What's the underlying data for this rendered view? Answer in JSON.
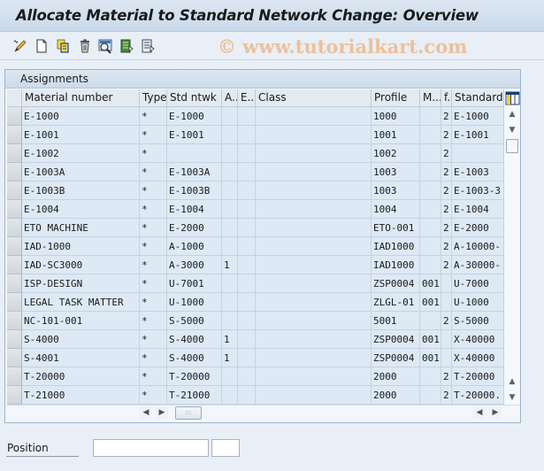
{
  "title": "Allocate Material to Standard Network Change: Overview",
  "watermark": "© www.tutorialkart.com",
  "toolbar": {
    "icons": [
      "display-change-icon",
      "new-entries-icon",
      "copy-as-icon",
      "delete-icon",
      "select-all-icon",
      "select-block-icon",
      "deselect-all-icon"
    ]
  },
  "table": {
    "section_title": "Assignments",
    "columns": [
      "Material number",
      "Type",
      "Std ntwk",
      "A..",
      "E..",
      "Class",
      "Profile",
      "M...",
      "f.",
      "Standard"
    ],
    "rows": [
      [
        "E-1000",
        "*",
        "E-1000",
        "",
        "",
        "",
        "1000",
        "",
        "2",
        "E-1000"
      ],
      [
        "E-1001",
        "*",
        "E-1001",
        "",
        "",
        "",
        "1001",
        "",
        "2",
        "E-1001"
      ],
      [
        "E-1002",
        "*",
        "",
        "",
        "",
        "",
        "1002",
        "",
        "2",
        ""
      ],
      [
        "E-1003A",
        "*",
        "E-1003A",
        "",
        "",
        "",
        "1003",
        "",
        "2",
        "E-1003"
      ],
      [
        "E-1003B",
        "*",
        "E-1003B",
        "",
        "",
        "",
        "1003",
        "",
        "2",
        "E-1003-3"
      ],
      [
        "E-1004",
        "*",
        "E-1004",
        "",
        "",
        "",
        "1004",
        "",
        "2",
        "E-1004"
      ],
      [
        "ETO MACHINE",
        "*",
        "E-2000",
        "",
        "",
        "",
        "ETO-001",
        "",
        "2",
        "E-2000"
      ],
      [
        "IAD-1000",
        "*",
        "A-1000",
        "",
        "",
        "",
        "IAD1000",
        "",
        "2",
        "A-10000-"
      ],
      [
        "IAD-SC3000",
        "*",
        "A-3000",
        "1",
        "",
        "",
        "IAD1000",
        "",
        "2",
        "A-30000-"
      ],
      [
        "ISP-DESIGN",
        "*",
        "U-7001",
        "",
        "",
        "",
        "ZSP0004",
        "001",
        "",
        "U-7000"
      ],
      [
        "LEGAL TASK MATTER",
        "*",
        "U-1000",
        "",
        "",
        "",
        "ZLGL-01",
        "001",
        "",
        "U-1000"
      ],
      [
        "NC-101-001",
        "*",
        "S-5000",
        "",
        "",
        "",
        "5001",
        "",
        "2",
        "S-5000"
      ],
      [
        "S-4000",
        "*",
        "S-4000",
        "1",
        "",
        "",
        "ZSP0004",
        "001",
        "",
        "X-40000"
      ],
      [
        "S-4001",
        "*",
        "S-4000",
        "1",
        "",
        "",
        "ZSP0004",
        "001",
        "",
        "X-40000"
      ],
      [
        "T-20000",
        "*",
        "T-20000",
        "",
        "",
        "",
        "2000",
        "",
        "2",
        "T-20000"
      ],
      [
        "T-21000",
        "*",
        "T-21000",
        "",
        "",
        "",
        "2000",
        "",
        "2",
        "T-20000."
      ]
    ]
  },
  "position": {
    "label": "Position",
    "value1": "",
    "value2": ""
  }
}
